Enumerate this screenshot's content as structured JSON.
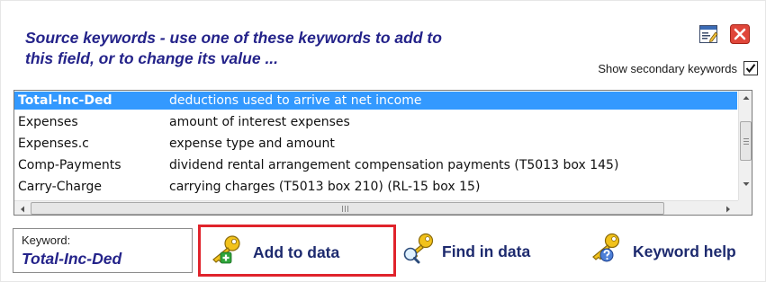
{
  "dialog": {
    "title_line1": "Source keywords  -  use one of these keywords to add to",
    "title_line2": "this field, or to change its value ...",
    "secondary_label": "Show secondary keywords",
    "secondary_checked": true
  },
  "toolbar": {
    "edit_icon": "edit-window-icon",
    "close_icon": "close-icon"
  },
  "keywords": [
    {
      "keyword": "Total-Inc-Ded",
      "description": "deductions used to arrive at net income",
      "selected": true
    },
    {
      "keyword": "Expenses",
      "description": "amount of interest expenses",
      "selected": false
    },
    {
      "keyword": "Expenses.c",
      "description": "expense type and amount",
      "selected": false
    },
    {
      "keyword": "Comp-Payments",
      "description": "dividend rental arrangement compensation payments (T5013 box 145)",
      "selected": false
    },
    {
      "keyword": "Carry-Charge",
      "description": "carrying charges (T5013 box 210) (RL-15 box 15)",
      "selected": false
    }
  ],
  "selected_keyword": {
    "label": "Keyword:",
    "value": "Total-Inc-Ded"
  },
  "buttons": {
    "add_label": "Add to data",
    "find_label": "Find in data",
    "help_label": "Keyword help"
  },
  "colors": {
    "title": "#24238a",
    "selection": "#3399ff",
    "highlight_border": "#e0232b",
    "close": "#e0463a"
  }
}
